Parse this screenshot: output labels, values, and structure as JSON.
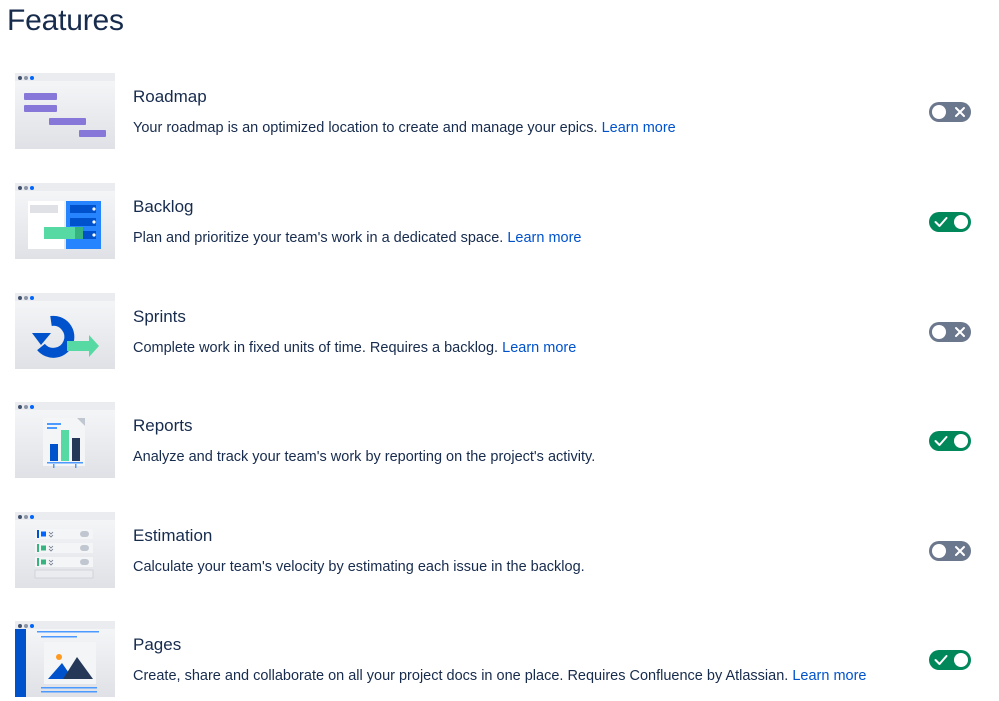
{
  "page": {
    "title": "Features"
  },
  "learn_more_label": "Learn more",
  "colors": {
    "toggle_on": "#00875A",
    "toggle_off": "#6B778C",
    "link": "#0052CC",
    "text": "#172B4D"
  },
  "features": [
    {
      "id": "roadmap",
      "title": "Roadmap",
      "description": "Your roadmap is an optimized location to create and manage your epics.",
      "has_learn_more": true,
      "enabled": false,
      "thumbnail_icon": "roadmap-illustration-icon"
    },
    {
      "id": "backlog",
      "title": "Backlog",
      "description": "Plan and prioritize your team's work in a dedicated space.",
      "has_learn_more": true,
      "enabled": true,
      "thumbnail_icon": "backlog-illustration-icon"
    },
    {
      "id": "sprints",
      "title": "Sprints",
      "description": "Complete work in fixed units of time. Requires a backlog.",
      "has_learn_more": true,
      "enabled": false,
      "thumbnail_icon": "sprints-illustration-icon"
    },
    {
      "id": "reports",
      "title": "Reports",
      "description": "Analyze and track your team's work by reporting on the project's activity.",
      "has_learn_more": false,
      "enabled": true,
      "thumbnail_icon": "reports-illustration-icon"
    },
    {
      "id": "estimation",
      "title": "Estimation",
      "description": "Calculate your team's velocity by estimating each issue in the backlog.",
      "has_learn_more": false,
      "enabled": false,
      "thumbnail_icon": "estimation-illustration-icon"
    },
    {
      "id": "pages",
      "title": "Pages",
      "description": "Create, share and collaborate on all your project docs in one place. Requires Confluence by Atlassian.",
      "has_learn_more": true,
      "enabled": true,
      "thumbnail_icon": "pages-illustration-icon"
    }
  ]
}
